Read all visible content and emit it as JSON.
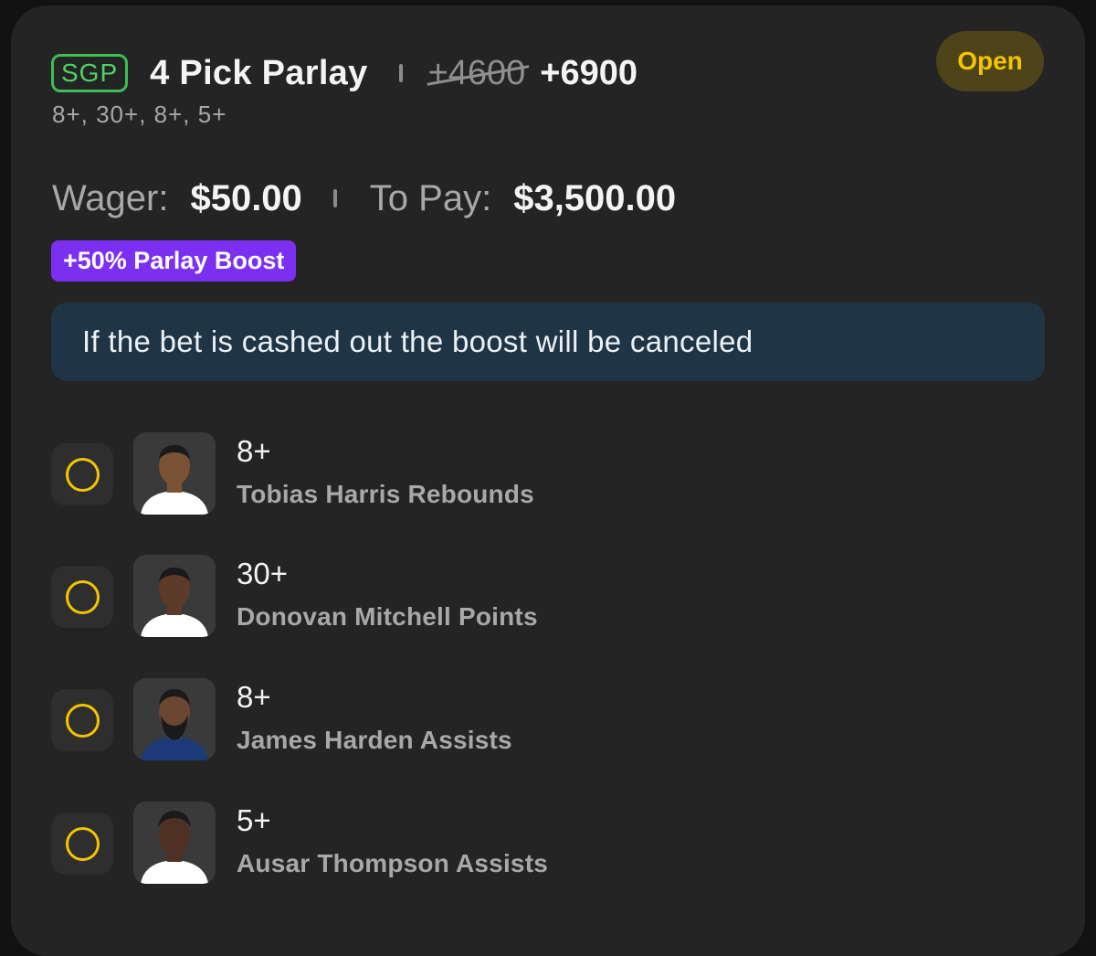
{
  "bet": {
    "badge": "SGP",
    "title": "4 Pick Parlay",
    "old_odds": "+4600",
    "new_odds": "+6900",
    "status": "Open",
    "subtitle": "8+, 30+, 8+, 5+"
  },
  "wager": {
    "wager_label": "Wager:",
    "wager_value": "$50.00",
    "topay_label": "To Pay:",
    "topay_value": "$3,500.00"
  },
  "boost": {
    "label": "+50% Parlay Boost",
    "notice": "If the bet is cashed out the boost will be canceled"
  },
  "legs": [
    {
      "line": "8+",
      "desc": "Tobias Harris Rebounds",
      "jersey_color": "#ffffff",
      "skin_color": "#7a5236"
    },
    {
      "line": "30+",
      "desc": "Donovan Mitchell Points",
      "jersey_color": "#ffffff",
      "skin_color": "#5e3b28"
    },
    {
      "line": "8+",
      "desc": "James Harden Assists",
      "jersey_color": "#1d3a78",
      "skin_color": "#6b4630"
    },
    {
      "line": "5+",
      "desc": "Ausar Thompson Assists",
      "jersey_color": "#ffffff",
      "skin_color": "#4e3122"
    }
  ],
  "colors": {
    "background": "#242424",
    "accent_yellow": "#f5c400",
    "sgp_green": "#3cbf52",
    "boost_purple": "#7b2ff0",
    "notice_bg": "#1f3546"
  }
}
